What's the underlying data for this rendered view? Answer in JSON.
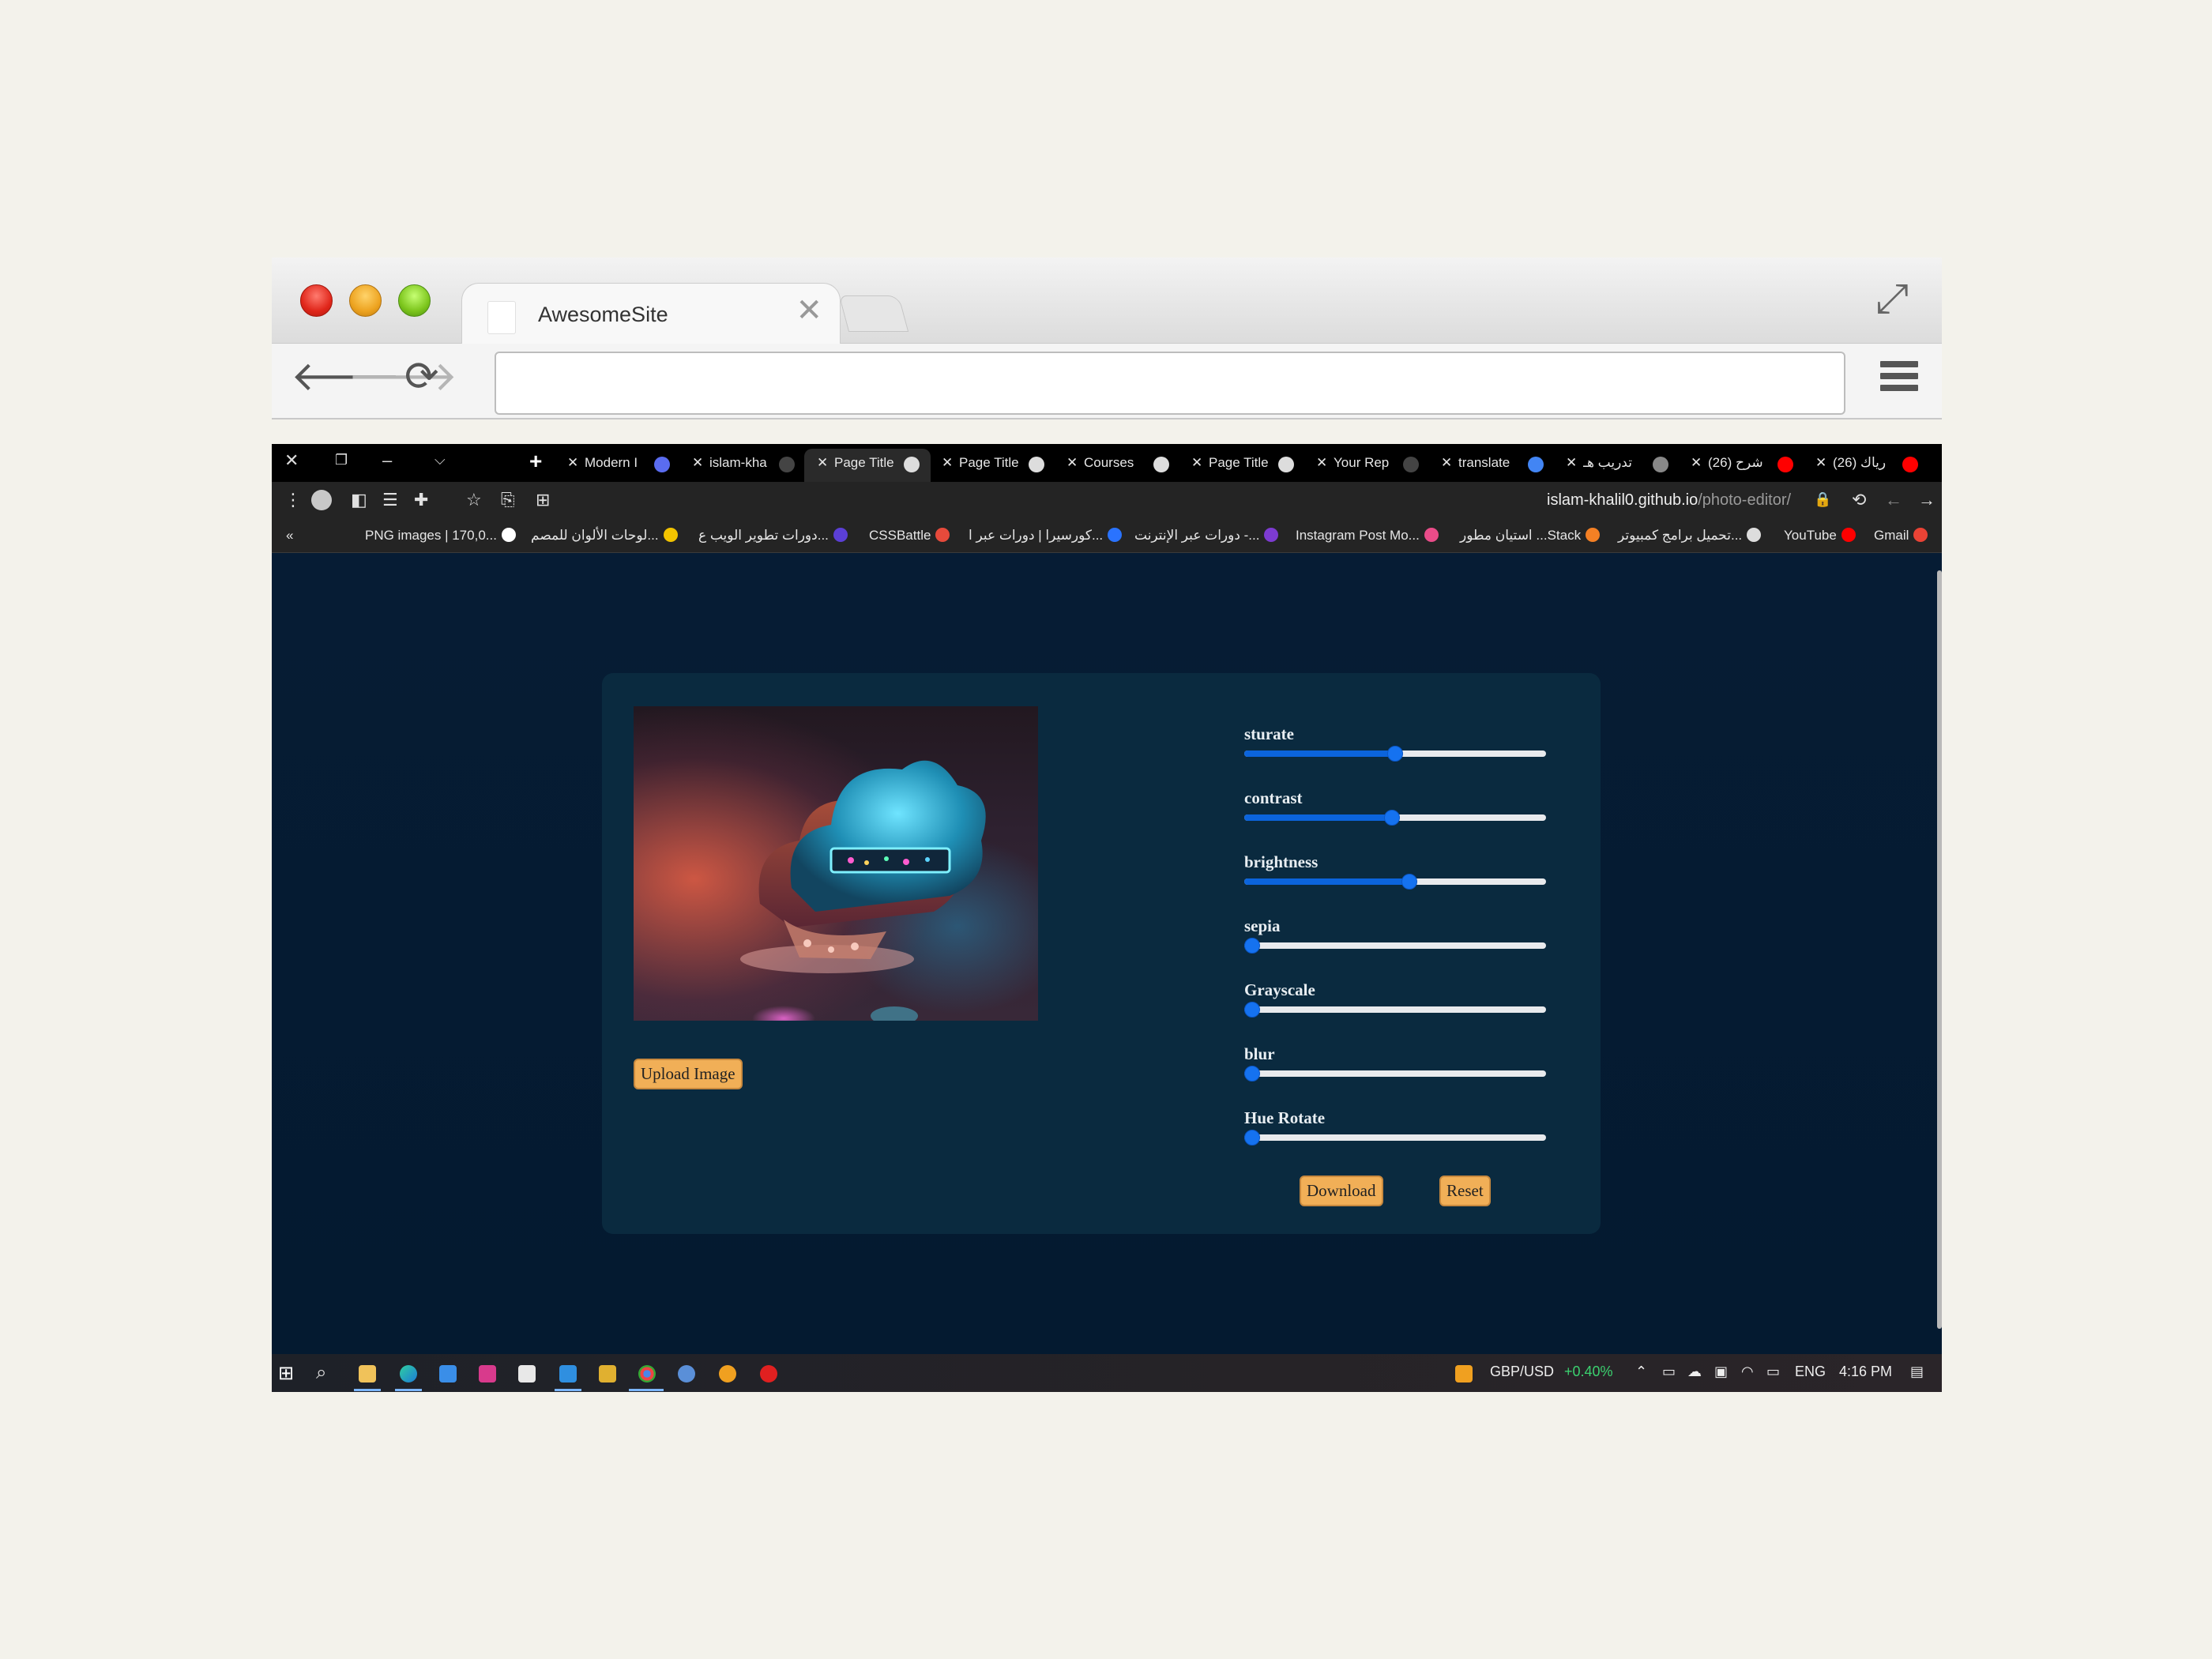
{
  "outer_browser": {
    "tab_title": "AwesomeSite",
    "address": ""
  },
  "inner_browser": {
    "tabs": [
      {
        "label": "Modern I",
        "active": false,
        "icon": "app-icon",
        "color": "#5a6cf0"
      },
      {
        "label": "islam-kha",
        "active": false,
        "icon": "github-icon",
        "color": "#444444"
      },
      {
        "label": "Page Title",
        "active": true,
        "icon": "globe-icon",
        "color": "#dddddd"
      },
      {
        "label": "Page Title",
        "active": false,
        "icon": "globe-icon",
        "color": "#dddddd"
      },
      {
        "label": "Courses",
        "active": false,
        "icon": "globe-icon",
        "color": "#dddddd"
      },
      {
        "label": "Page Title",
        "active": false,
        "icon": "globe-icon",
        "color": "#dddddd"
      },
      {
        "label": "Your Rep",
        "active": false,
        "icon": "github-icon",
        "color": "#444444"
      },
      {
        "label": "translate",
        "active": false,
        "icon": "google-icon",
        "color": "#4285f4"
      },
      {
        "label": "تدريب هـ",
        "active": false,
        "icon": "app-icon",
        "color": "#888888"
      },
      {
        "label": "(26) شرح",
        "active": false,
        "icon": "youtube-icon",
        "color": "#ff0000"
      },
      {
        "label": "(26) رياك",
        "active": false,
        "icon": "youtube-icon",
        "color": "#ff0000"
      }
    ],
    "url_host": "islam-khalil0.github.io",
    "url_path": "/photo-editor/",
    "bookmarks": [
      {
        "label": "PNG images | 170,0...",
        "color": "#ffffff"
      },
      {
        "label": "لوحات الألوان للمصم...",
        "color": "#f2c300"
      },
      {
        "label": "دورات تطوير الويب ع...",
        "color": "#5b3fd6"
      },
      {
        "label": "CSSBattle",
        "color": "#e64a3b"
      },
      {
        "label": "كورسيرا | دورات عبر ا...",
        "color": "#2a73ff"
      },
      {
        "label": "دورات عبر الإنترنت -...",
        "color": "#7d3bd1"
      },
      {
        "label": "Instagram Post Mo...",
        "color": "#ea4c89"
      },
      {
        "label": "استيان مطور ...Stack",
        "color": "#f48024"
      },
      {
        "label": "تحميل برامج كمبيوتر...",
        "color": "#dddddd"
      },
      {
        "label": "YouTube",
        "color": "#ff0000"
      },
      {
        "label": "Gmail",
        "color": "#ea4335"
      }
    ]
  },
  "editor": {
    "upload_label": "Upload Image",
    "download_label": "Download",
    "reset_label": "Reset",
    "filters": [
      {
        "label": "sturate",
        "value": 0.5
      },
      {
        "label": "contrast",
        "value": 0.49
      },
      {
        "label": "brightness",
        "value": 0.55
      },
      {
        "label": "sepia",
        "value": 0.0
      },
      {
        "label": "Grayscale",
        "value": 0.0
      },
      {
        "label": "blur",
        "value": 0.0
      },
      {
        "label": "Hue Rotate",
        "value": 0.0
      }
    ]
  },
  "taskbar": {
    "currency_pair": "GBP/USD",
    "currency_change": "+0.40%",
    "language": "ENG",
    "time": "4:16 PM"
  },
  "colors": {
    "page_bg": "#061c34",
    "card_bg": "#0a2a3f",
    "button_bg": "#f1af57",
    "slider_fill": "#0b64dc",
    "positive_change": "#3bd16f"
  }
}
